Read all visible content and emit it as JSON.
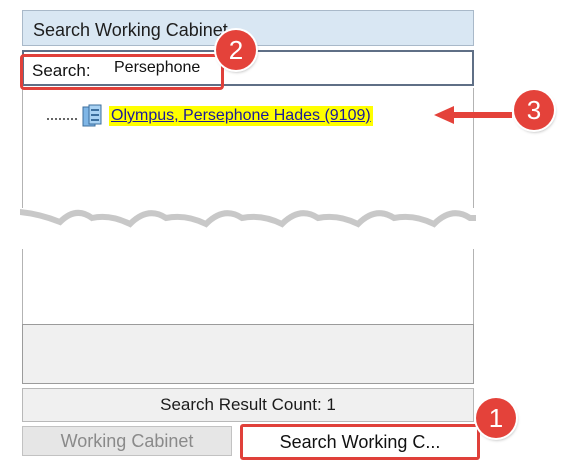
{
  "window": {
    "title": "Search Working Cabinet"
  },
  "search": {
    "label": "Search:",
    "value": "Persephone"
  },
  "results": {
    "items": [
      {
        "label": "Olympus, Persephone  Hades (9109)",
        "icon": "cabinet-icon",
        "highlight": "#ffff00"
      }
    ]
  },
  "status": {
    "count_text": "Search Result Count: 1"
  },
  "tabs": [
    {
      "label": "Working Cabinet",
      "active": false
    },
    {
      "label": "Search Working C...",
      "active": true
    }
  ],
  "callouts": {
    "one": "1",
    "two": "2",
    "three": "3",
    "color": "#e0403a"
  }
}
